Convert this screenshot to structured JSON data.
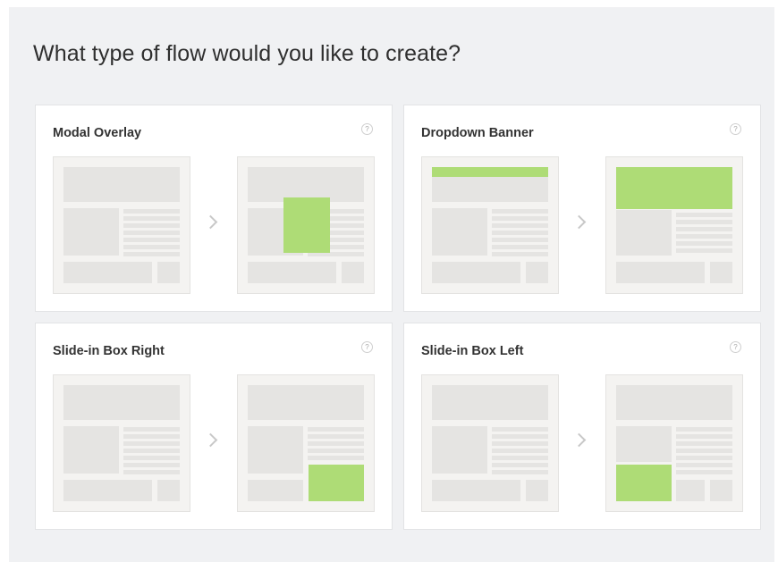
{
  "heading": "What type of flow would you like to create?",
  "colors": {
    "highlight_green": "#aedc76",
    "wire_gray": "#e5e4e2",
    "panel_bg": "#f0f1f3"
  },
  "flows": [
    {
      "title": "Modal Overlay",
      "variant": "modal"
    },
    {
      "title": "Dropdown Banner",
      "variant": "dropdown"
    },
    {
      "title": "Slide-in Box Right",
      "variant": "slide-right"
    },
    {
      "title": "Slide-in Box Left",
      "variant": "slide-left"
    }
  ],
  "icons": {
    "help": "help-icon",
    "arrow": "chevron-right-icon"
  }
}
